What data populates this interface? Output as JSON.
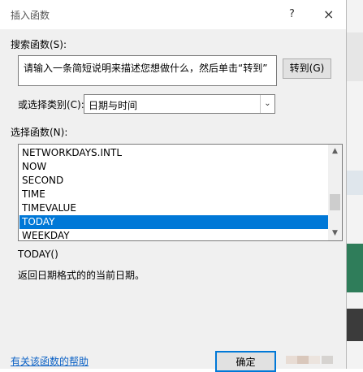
{
  "dialog": {
    "title": "插入函数",
    "help_glyph": "?",
    "close_glyph": "×"
  },
  "search": {
    "label": "搜索函数(S):",
    "value": "请输入一条简短说明来描述您想做什么，然后单击“转到”",
    "goto_label": "转到(G)"
  },
  "category": {
    "label": "或选择类别(C):",
    "selected": "日期与时间",
    "arrow": "⌄"
  },
  "functions": {
    "label": "选择函数(N):",
    "items": [
      "NETWORKDAYS.INTL",
      "NOW",
      "SECOND",
      "TIME",
      "TIMEVALUE",
      "TODAY",
      "WEEKDAY"
    ],
    "selected": "TODAY"
  },
  "details": {
    "syntax": "TODAY()",
    "description": "返回日期格式的的当前日期。"
  },
  "footer": {
    "help_link": "有关该函数的帮助",
    "ok_label": "确定"
  },
  "colors": {
    "selection": "#0078d7",
    "link": "#0b61c5",
    "dialog_bg": "#f0f0f0"
  }
}
